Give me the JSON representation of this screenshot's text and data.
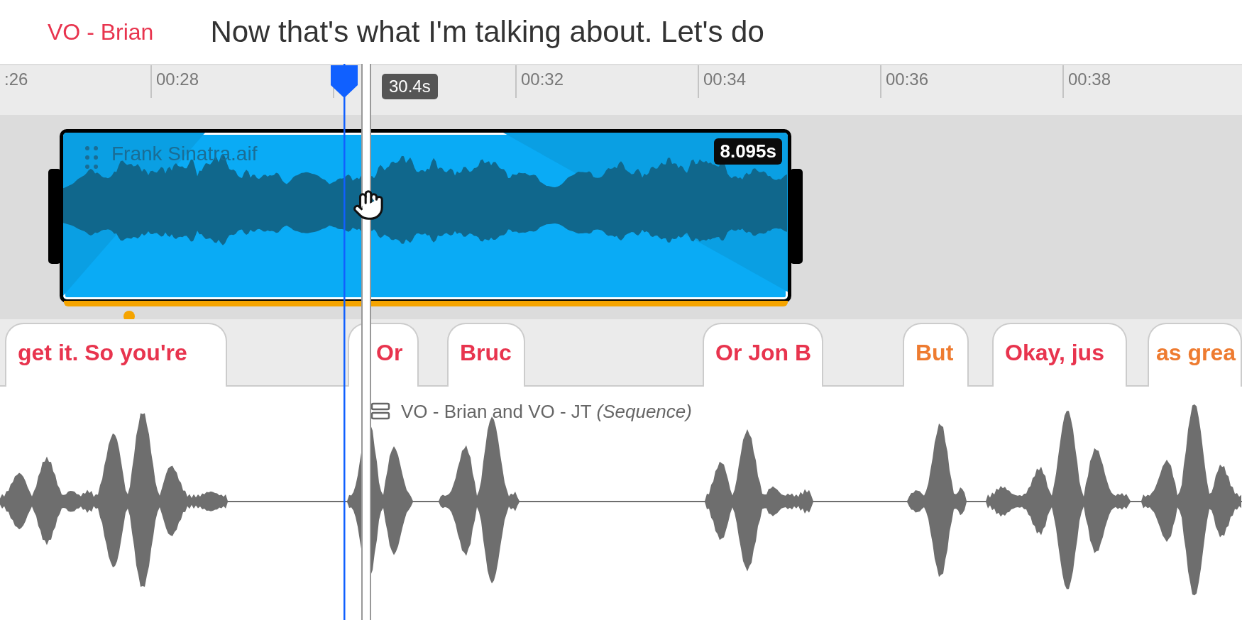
{
  "header": {
    "speaker": "VO - Brian",
    "line": "Now that's what I'm talking about. Let's do"
  },
  "ruler": {
    "ticks": [
      ":26",
      "00:28",
      "00:32",
      "00:34",
      "00:36",
      "00:38"
    ]
  },
  "playhead": {
    "time": "30.4s"
  },
  "clip": {
    "name": "Frank Sinatra.aif",
    "duration": "8.095s",
    "selected": true
  },
  "words": [
    {
      "text": "get it. So you're",
      "color": "#e8344e"
    },
    {
      "text": "Or",
      "color": "#e8344e"
    },
    {
      "text": "Bruc",
      "color": "#e8344e"
    },
    {
      "text": "Or Jon B",
      "color": "#e8344e"
    },
    {
      "text": "But",
      "color": "#ee7b30"
    },
    {
      "text": "Okay, jus",
      "color": "#e8344e"
    },
    {
      "text": "as grea",
      "color": "#ee7b30"
    }
  ],
  "sequence": {
    "label": "VO - Brian and VO - JT *(Sequence)*"
  }
}
